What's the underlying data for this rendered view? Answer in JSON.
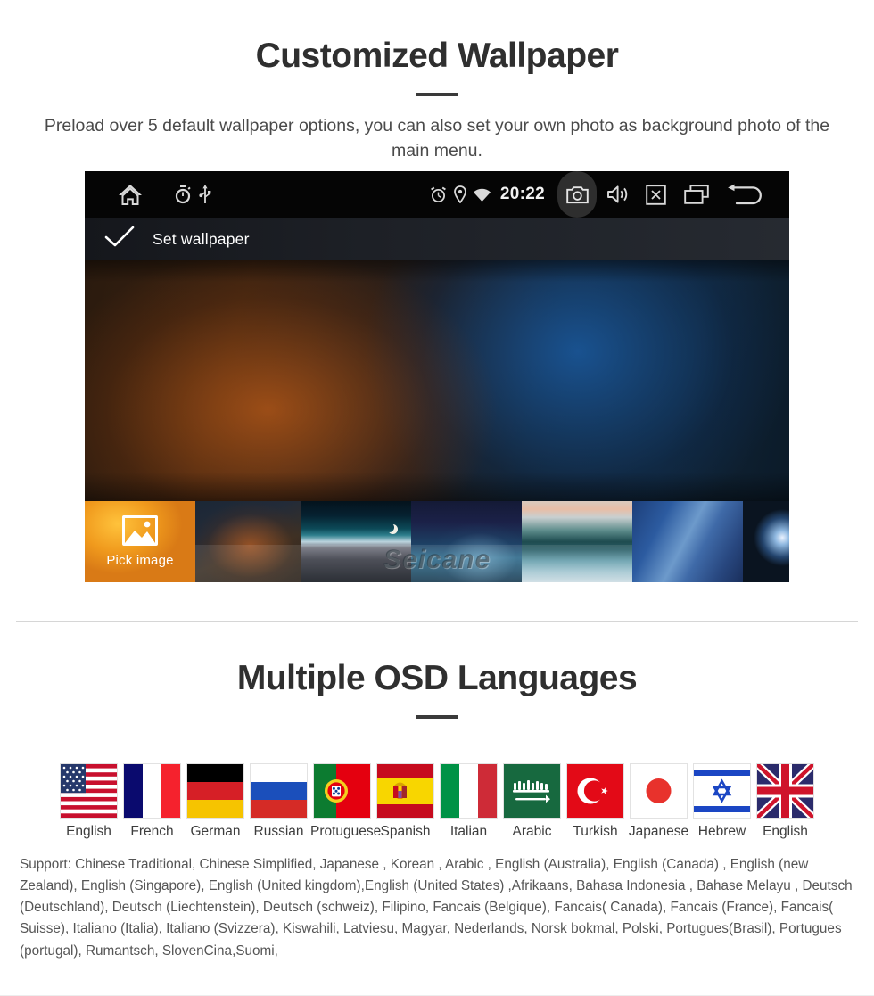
{
  "section1": {
    "title": "Customized Wallpaper",
    "subtitle": "Preload over 5 default wallpaper options, you can also set your own photo as background photo of the main menu."
  },
  "device": {
    "statusbar": {
      "left_icons": [
        "home-icon",
        "stopwatch-icon",
        "usb-icon"
      ],
      "alarm_icon": "alarm-icon",
      "location_icon": "location-pin-icon",
      "wifi_icon": "wifi-icon",
      "time": "20:22",
      "camera_icon": "camera-icon",
      "volume_icon": "volume-icon",
      "close_icon": "close-box-icon",
      "recents_icon": "recent-apps-icon",
      "back_icon": "back-arrow-icon"
    },
    "actionbar": {
      "check_icon": "checkmark-icon",
      "label": "Set wallpaper"
    },
    "thumbnails": [
      {
        "name": "pick-image",
        "label": "Pick image",
        "icon": "photo-icon"
      },
      {
        "name": "wallpaper-bokeh-warm",
        "label": ""
      },
      {
        "name": "wallpaper-aurora-earth",
        "label": ""
      },
      {
        "name": "wallpaper-starfield",
        "label": ""
      },
      {
        "name": "wallpaper-wave",
        "label": ""
      },
      {
        "name": "wallpaper-blue-geometry",
        "label": ""
      },
      {
        "name": "wallpaper-eclipse",
        "label": ""
      }
    ],
    "watermark": "Seicane"
  },
  "section2": {
    "title": "Multiple OSD Languages",
    "flags": [
      {
        "name": "usa",
        "label": "English"
      },
      {
        "name": "france",
        "label": "French"
      },
      {
        "name": "germany",
        "label": "German"
      },
      {
        "name": "russia",
        "label": "Russian"
      },
      {
        "name": "portugal",
        "label": "Protuguese"
      },
      {
        "name": "spain",
        "label": "Spanish"
      },
      {
        "name": "italy",
        "label": "Italian"
      },
      {
        "name": "saudi-arabia",
        "label": "Arabic"
      },
      {
        "name": "turkey",
        "label": "Turkish"
      },
      {
        "name": "japan",
        "label": "Japanese"
      },
      {
        "name": "israel",
        "label": "Hebrew"
      },
      {
        "name": "united-kingdom",
        "label": "English"
      }
    ],
    "support_text": "Support: Chinese Traditional, Chinese Simplified, Japanese , Korean , Arabic , English (Australia), English (Canada) , English (new Zealand), English (Singapore), English (United kingdom),English (United States) ,Afrikaans, Bahasa Indonesia , Bahase Melayu , Deutsch (Deutschland), Deutsch (Liechtenstein), Deutsch (schweiz), Filipino, Fancais (Belgique), Fancais( Canada), Fancais (France), Fancais( Suisse), Italiano (Italia), Italiano (Svizzera), Kiswahili, Latviesu, Magyar, Nederlands, Norsk bokmal, Polski, Portugues(Brasil), Portugues (portugal), Rumantsch, SlovenCina,Suomi,"
  },
  "colors": {
    "heading": "#2f2f2f",
    "body_text": "#4a4a4a",
    "divider": "#d6d6d6",
    "device_bg": "#000000"
  }
}
